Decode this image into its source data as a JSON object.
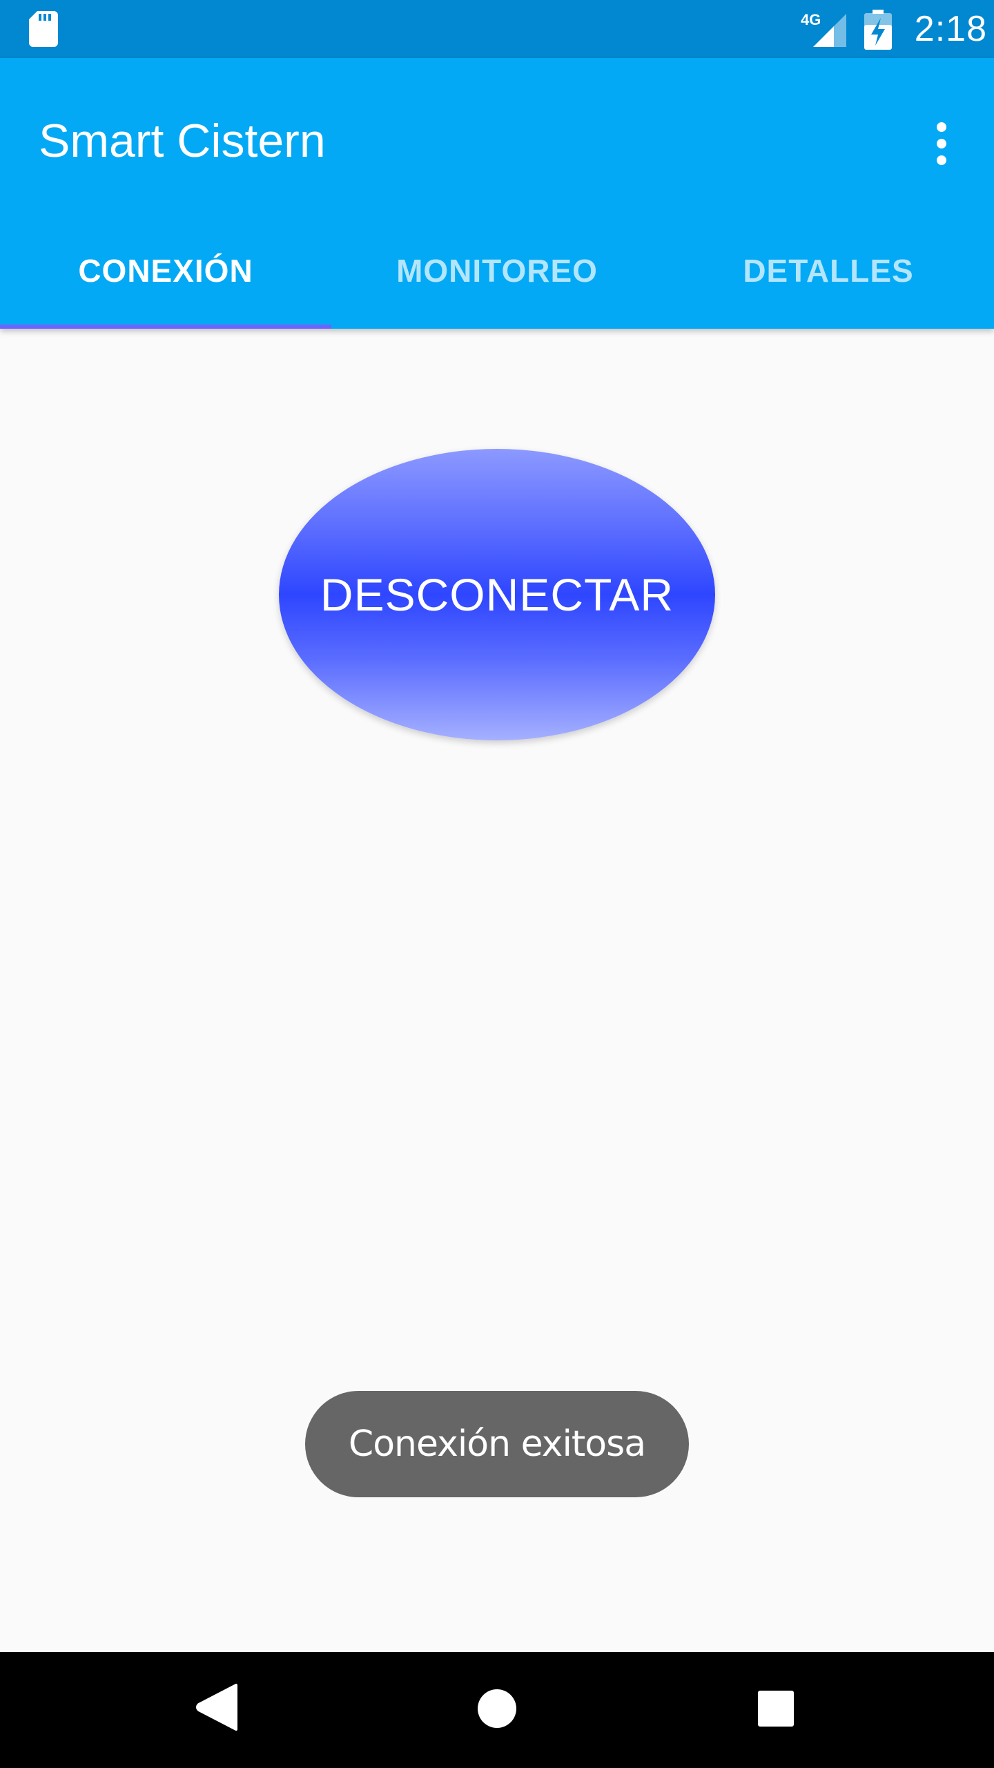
{
  "status_bar": {
    "time": "2:18",
    "network_label": "4G",
    "icons": [
      "sd-card-icon",
      "cell-signal-4g-icon",
      "battery-charging-icon"
    ]
  },
  "app_bar": {
    "title": "Smart Cistern",
    "overflow_icon": "more-vert-icon"
  },
  "tabs": [
    {
      "label": "CONEXIÓN",
      "selected": true
    },
    {
      "label": "MONITOREO",
      "selected": false
    },
    {
      "label": "DETALLES",
      "selected": false
    }
  ],
  "main": {
    "disconnect_label": "DESCONECTAR"
  },
  "toast": {
    "message": "Conexión exitosa"
  },
  "nav_bar": {
    "icons": [
      "back-icon",
      "home-icon",
      "recents-icon"
    ]
  },
  "colors": {
    "status_bar": "#0288d1",
    "app_bar": "#03a9f4",
    "tab_indicator": "#6e63ff",
    "button_center": "#2e46ff",
    "toast_bg": "#666666",
    "background": "#fafafa"
  }
}
